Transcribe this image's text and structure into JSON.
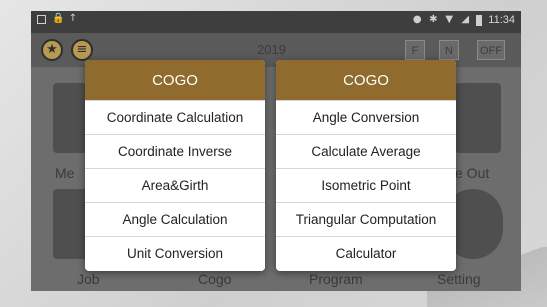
{
  "status_bar": {
    "time": "11:34"
  },
  "top_bar": {
    "year_label": "2019",
    "mode_buttons": [
      "F",
      "N",
      "OFF"
    ]
  },
  "background_apps": {
    "row1_left_label": "Me",
    "row1_right_label": "e Out",
    "row2_labels": [
      "Job",
      "Cogo",
      "Program",
      "Setting"
    ]
  },
  "menu_left": {
    "title": "COGO",
    "items": [
      "Coordinate Calculation",
      "Coordinate Inverse",
      "Area&Girth",
      "Angle Calculation",
      "Unit Conversion"
    ]
  },
  "menu_right": {
    "title": "COGO",
    "items": [
      "Angle Conversion",
      "Calculate Average",
      "Isometric Point",
      "Triangular Computation",
      "Calculator"
    ]
  },
  "colors": {
    "menu_header": "#8f6b2e",
    "accent_icon": "#b79a52",
    "status_bar": "#3e3e3e"
  },
  "icons": [
    "sim-card-icon",
    "lock-icon",
    "upload-icon",
    "location-icon",
    "bluetooth-icon",
    "wifi-icon",
    "signal-icon",
    "battery-icon",
    "star-icon",
    "database-icon"
  ]
}
